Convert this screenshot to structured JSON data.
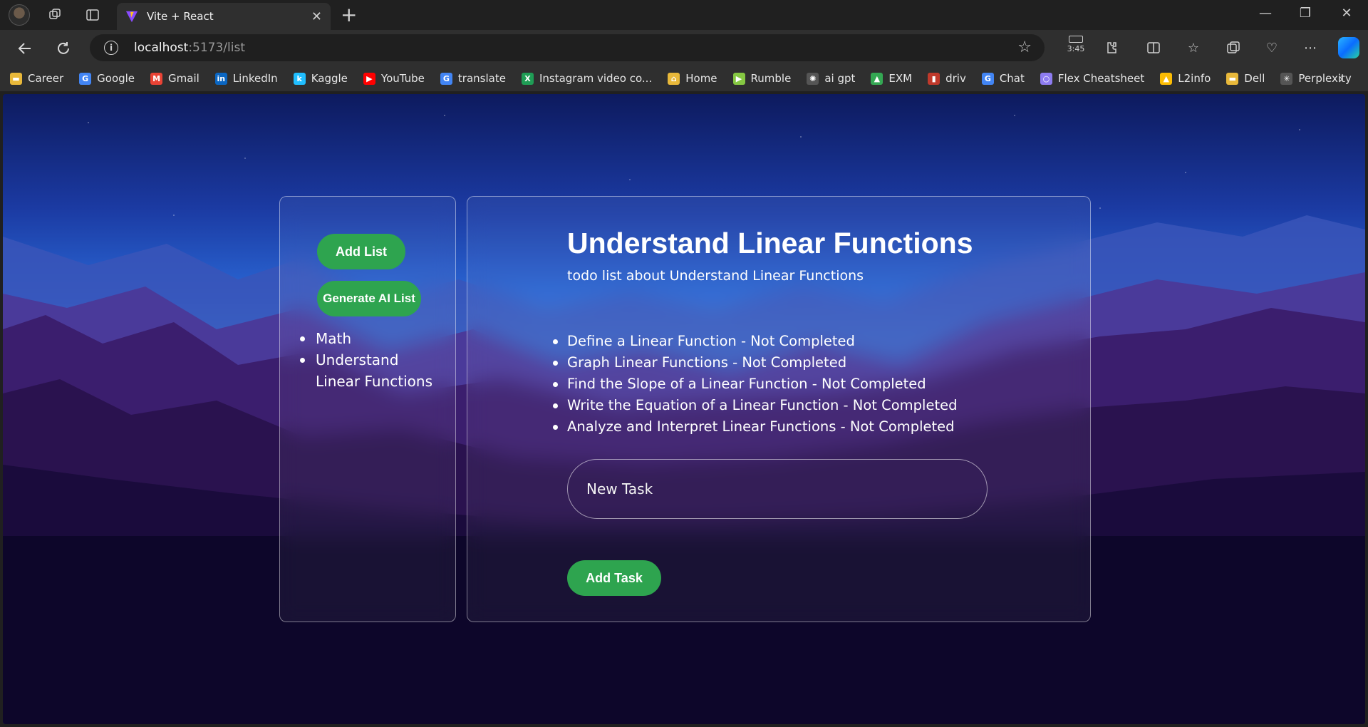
{
  "browser": {
    "tab_title": "Vite + React",
    "url_host": "localhost",
    "url_path": ":5173/list",
    "battery_time": "3:45",
    "bookmarks": [
      {
        "label": "Career",
        "icon": "folder-icon",
        "color": "#e8b83a"
      },
      {
        "label": "Google",
        "icon": "google-icon",
        "color": "#4285f4"
      },
      {
        "label": "Gmail",
        "icon": "gmail-icon",
        "color": "#ea4335"
      },
      {
        "label": "LinkedIn",
        "icon": "linkedin-icon",
        "color": "#0a66c2"
      },
      {
        "label": "Kaggle",
        "icon": "kaggle-icon",
        "color": "#20beff"
      },
      {
        "label": "YouTube",
        "icon": "youtube-icon",
        "color": "#ff0000"
      },
      {
        "label": "translate",
        "icon": "translate-icon",
        "color": "#4285f4"
      },
      {
        "label": "Instagram video co...",
        "icon": "instagram-tool-icon",
        "color": "#1f9d55"
      },
      {
        "label": "Home",
        "icon": "home-icon",
        "color": "#e8b83a"
      },
      {
        "label": "Rumble",
        "icon": "rumble-icon",
        "color": "#85c742"
      },
      {
        "label": "ai gpt",
        "icon": "openai-icon",
        "color": "#555555"
      },
      {
        "label": "EXM",
        "icon": "drive-icon",
        "color": "#34a853"
      },
      {
        "label": "driv",
        "icon": "driv-icon",
        "color": "#c0392b"
      },
      {
        "label": "Chat",
        "icon": "google-chat-icon",
        "color": "#4285f4"
      },
      {
        "label": "Flex Cheatsheet",
        "icon": "circle-icon",
        "color": "#8e7cf0"
      },
      {
        "label": "L2info",
        "icon": "drive-icon",
        "color": "#fbbc04"
      },
      {
        "label": "Dell",
        "icon": "folder-icon",
        "color": "#e8b83a"
      },
      {
        "label": "Perplexity",
        "icon": "perplexity-icon",
        "color": "#555555"
      }
    ]
  },
  "sidebar": {
    "add_list_label": "Add List",
    "generate_ai_label": "Generate AI List",
    "lists": [
      "Math",
      "Understand Linear Functions"
    ]
  },
  "main": {
    "title": "Understand Linear Functions",
    "subtitle": "todo list about Understand Linear Functions",
    "tasks": [
      "Define a Linear Function - Not Completed",
      "Graph Linear Functions - Not Completed",
      "Find the Slope of a Linear Function - Not Completed",
      "Write the Equation of a Linear Function - Not Completed",
      "Analyze and Interpret Linear Functions - Not Completed"
    ],
    "new_task_placeholder": "New Task",
    "add_task_label": "Add Task"
  },
  "colors": {
    "accent_green": "#2ea44f",
    "browser_dark": "#202020",
    "toolbar": "#2f2f2f"
  }
}
